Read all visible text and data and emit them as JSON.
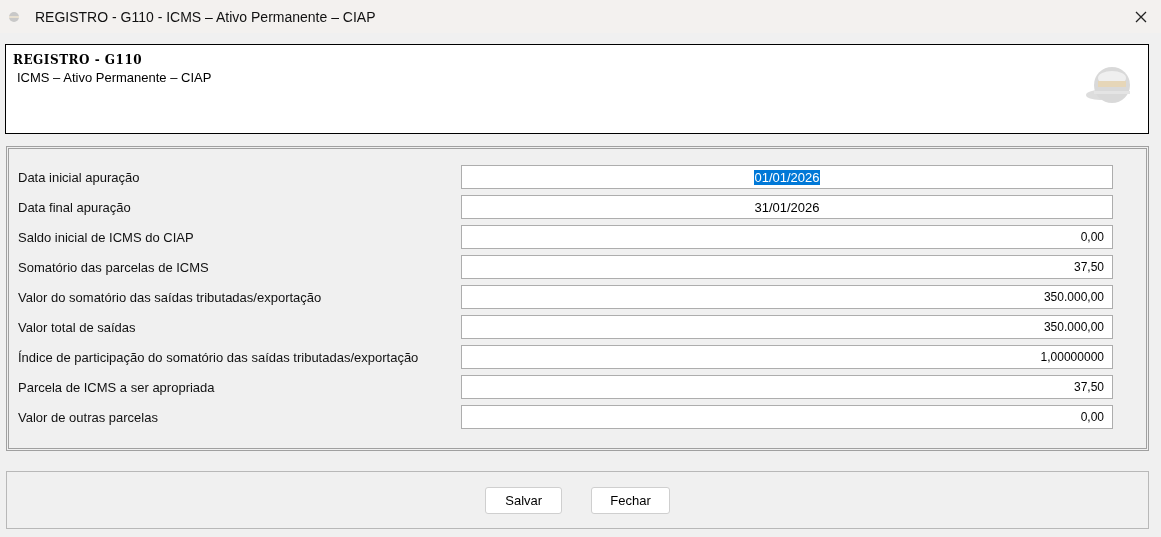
{
  "window": {
    "title": "REGISTRO - G110 - ICMS – Ativo Permanente – CIAP"
  },
  "header": {
    "title": "REGISTRO - G110",
    "subtitle": "ICMS – Ativo Permanente – CIAP"
  },
  "fields": [
    {
      "label": "Data inicial apuração",
      "value": "01/01/2026",
      "kind": "date",
      "text_selected": true
    },
    {
      "label": "Data final apuração",
      "value": "31/01/2026",
      "kind": "date",
      "text_selected": false
    },
    {
      "label": "Saldo inicial de ICMS do CIAP",
      "value": "0,00",
      "kind": "number",
      "text_selected": false
    },
    {
      "label": "Somatório das parcelas de ICMS",
      "value": "37,50",
      "kind": "number",
      "text_selected": false
    },
    {
      "label": "Valor do somatório das saídas tributadas/exportação",
      "value": "350.000,00",
      "kind": "number",
      "text_selected": false
    },
    {
      "label": "Valor total de saídas",
      "value": "350.000,00",
      "kind": "number",
      "text_selected": false
    },
    {
      "label": "Índice de participação do somatório das saídas tributadas/exportação",
      "value": "1,00000000",
      "kind": "number",
      "text_selected": false
    },
    {
      "label": "Parcela de ICMS a ser apropriada",
      "value": "37,50",
      "kind": "number",
      "text_selected": false
    },
    {
      "label": "Valor de outras parcelas",
      "value": "0,00",
      "kind": "number",
      "text_selected": false
    }
  ],
  "buttons": [
    "Salvar",
    "Fechar"
  ]
}
